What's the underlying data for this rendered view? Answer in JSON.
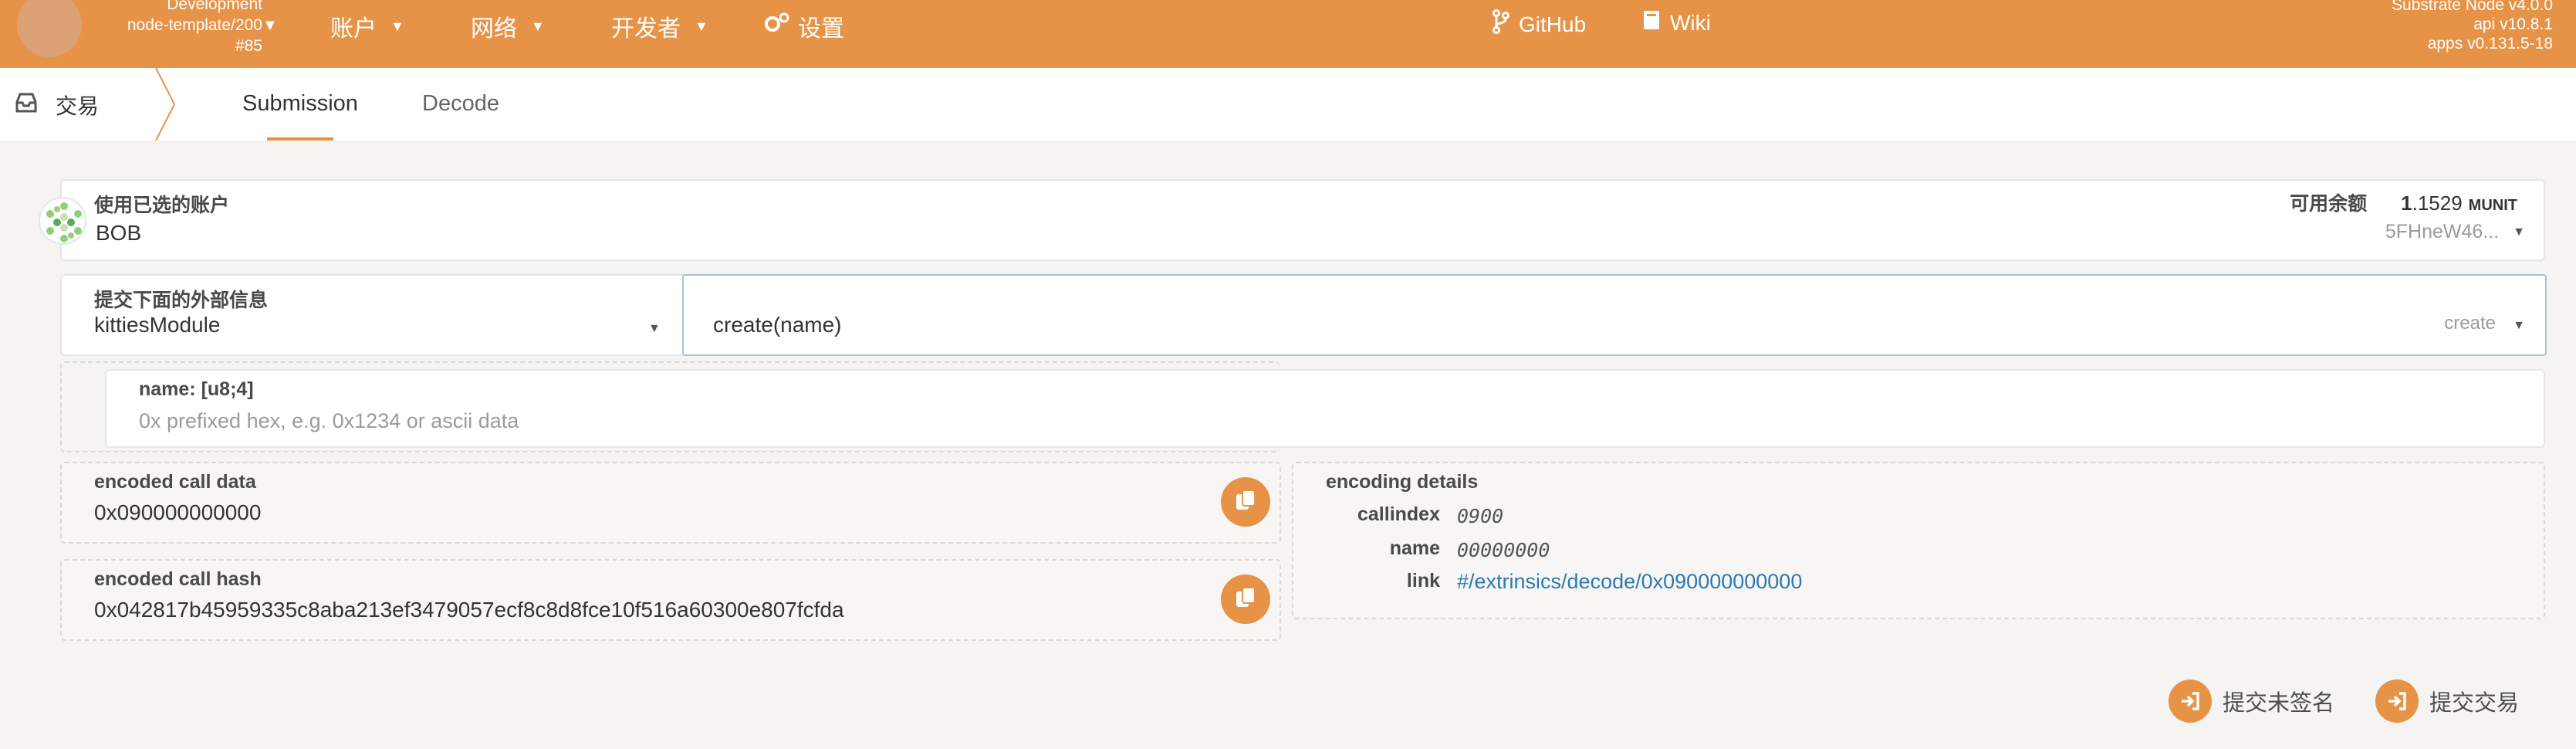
{
  "topbar": {
    "chain_name": "Development",
    "node_name": "node-template/200",
    "block": "#85",
    "menu": [
      {
        "label": "账户"
      },
      {
        "label": "网络"
      },
      {
        "label": "开发者"
      },
      {
        "label": "设置"
      }
    ],
    "links": [
      {
        "label": "GitHub"
      },
      {
        "label": "Wiki"
      }
    ],
    "version_node": "Substrate Node v4.0.0",
    "version_api": "api v10.8.1",
    "version_apps": "apps v0.131.5-18"
  },
  "tabs": {
    "app_name": "交易",
    "items": [
      {
        "label": "Submission",
        "active": true
      },
      {
        "label": "Decode",
        "active": false
      }
    ]
  },
  "account": {
    "label": "使用已选的账户",
    "name": "BOB",
    "balance_label": "可用余额",
    "balance_int": "1",
    "balance_dec": ".1529",
    "balance_unit": "MUNIT",
    "address": "5FHneW46..."
  },
  "extrinsic": {
    "label": "提交下面的外部信息",
    "module": "kittiesModule",
    "call": "create(name)",
    "method": "create"
  },
  "param": {
    "label": "name: [u8;4]",
    "placeholder": "0x prefixed hex, e.g. 0x1234 or ascii data"
  },
  "encoded": {
    "call_data_label": "encoded call data",
    "call_data": "0x090000000000",
    "call_hash_label": "encoded call hash",
    "call_hash": "0x042817b45959335c8aba213ef3479057ecf8c8d8fce10f516a60300e807fcfda"
  },
  "details": {
    "title": "encoding details",
    "rows": [
      {
        "key": "callindex",
        "value": "0900"
      },
      {
        "key": "name",
        "value": "00000000"
      },
      {
        "key": "link",
        "value": "#/extrinsics/decode/0x090000000000"
      }
    ]
  },
  "actions": {
    "unsigned_label": "提交未签名",
    "submit_label": "提交交易"
  },
  "colors": {
    "accent": "#e79347",
    "link": "#2a7ab0"
  }
}
